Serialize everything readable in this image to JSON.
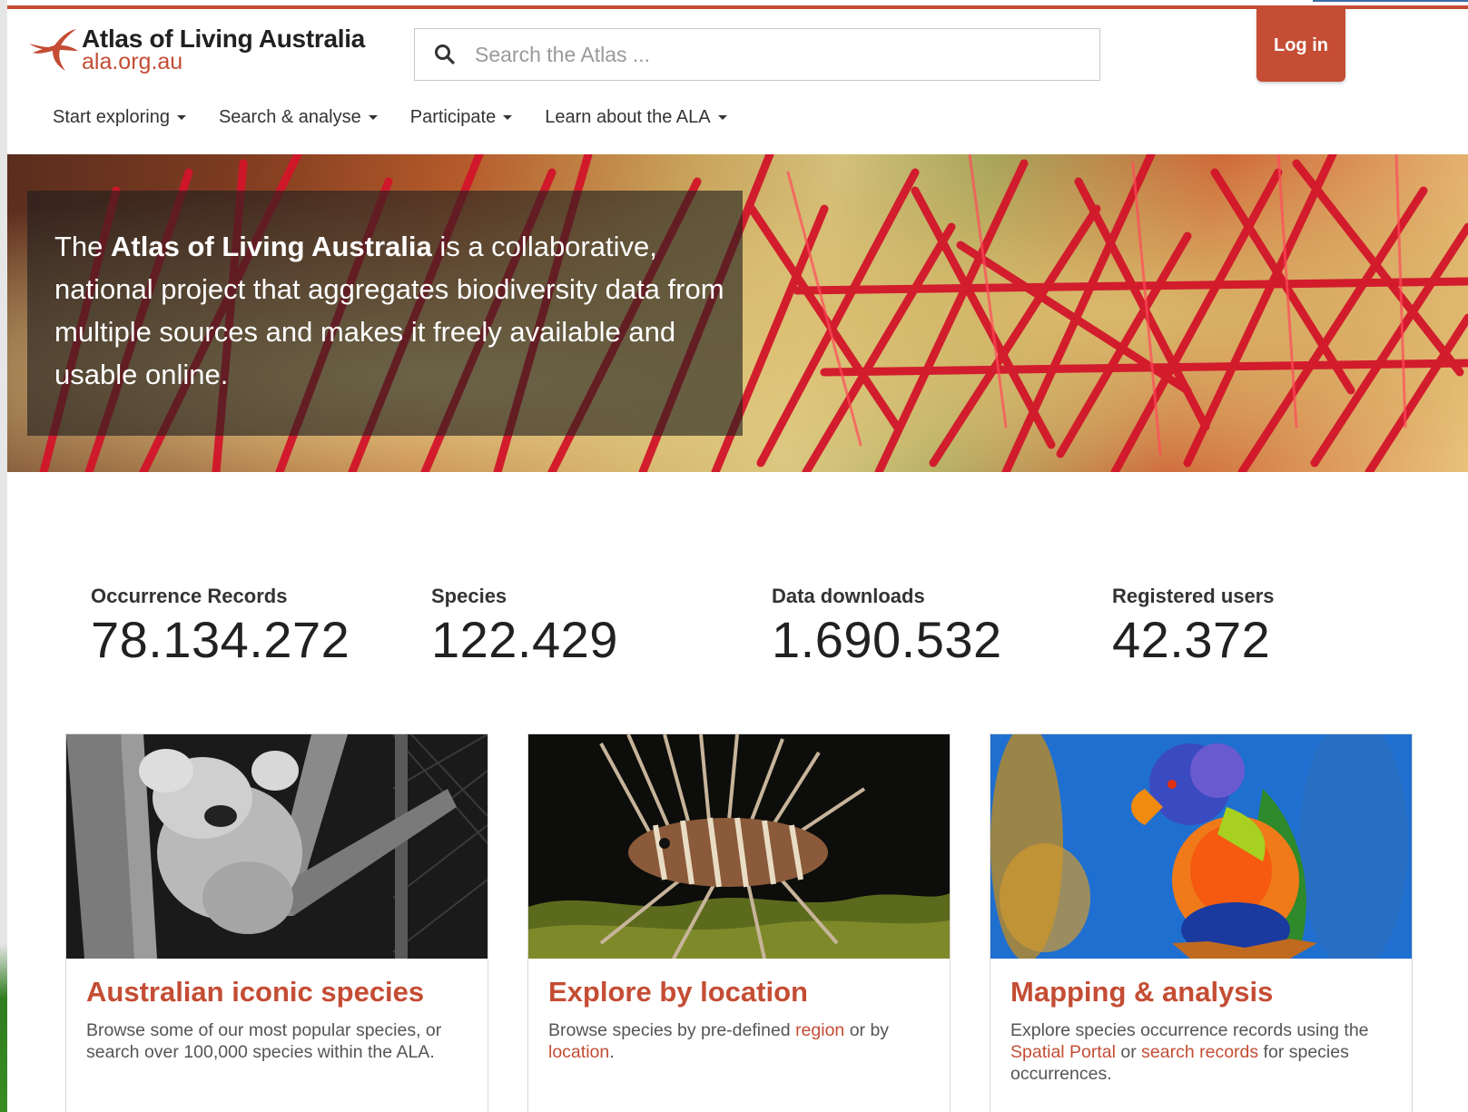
{
  "header": {
    "logo_title": "Atlas of Living Australia",
    "logo_sub": "ala.org.au",
    "search_placeholder": "Search the Atlas ...",
    "login_label": "Log in"
  },
  "nav": {
    "items": [
      {
        "label": "Start exploring"
      },
      {
        "label": "Search & analyse"
      },
      {
        "label": "Participate"
      },
      {
        "label": "Learn about the ALA"
      }
    ]
  },
  "hero": {
    "intro": "The ",
    "emphasis": "Atlas of Living Australia",
    "rest": " is a collaborative, national project that aggregates biodiversity data from multiple sources and makes it freely available and usable online."
  },
  "stats": [
    {
      "label": "Occurrence Records",
      "value": "78.134.272"
    },
    {
      "label": "Species",
      "value": "122.429"
    },
    {
      "label": "Data downloads",
      "value": "1.690.532"
    },
    {
      "label": "Registered users",
      "value": "42.372"
    }
  ],
  "cards": [
    {
      "title": "Australian iconic species",
      "desc": "Browse some of our most popular species, or search over 100,000 species within the ALA."
    },
    {
      "title": "Explore by location",
      "desc_a": "Browse species by pre-defined ",
      "link_region": "region",
      "desc_b": " or by ",
      "link_location": "location",
      "desc_c": "."
    },
    {
      "title": "Mapping & analysis",
      "desc_a": "Explore species occurrence records using the ",
      "link_spatial": "Spatial Portal",
      "desc_b": " or ",
      "link_search": "search records",
      "desc_c": " for species occurrences."
    }
  ],
  "colors": {
    "brand": "#c44d34",
    "text": "#212121"
  }
}
